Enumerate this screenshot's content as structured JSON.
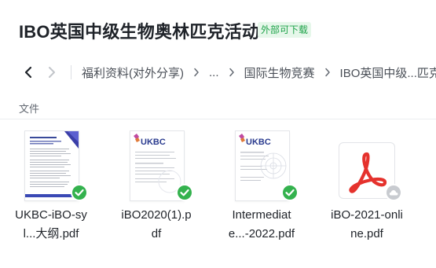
{
  "header": {
    "title": "IBO英国中级生物奥林匹克活动",
    "badge": "外部可下载"
  },
  "nav": {
    "back_icon": "chevron-left-icon",
    "forward_icon": "chevron-right-icon",
    "breadcrumbs": [
      "福利资料(对外分享)",
      "...",
      "国际生物竞赛",
      "IBO英国中级...匹克"
    ]
  },
  "section": {
    "label": "文件"
  },
  "files": [
    {
      "name_line1": "UKBC-iBO-sy",
      "name_line2": "l...大纲.pdf",
      "status": "synced-check-icon",
      "thumb": "document-preview"
    },
    {
      "name_line1": "iBO2020(1).p",
      "name_line2": "df",
      "status": "synced-check-icon",
      "thumb": "document-preview"
    },
    {
      "name_line1": "Intermediat",
      "name_line2": "e...-2022.pdf",
      "status": "synced-check-icon",
      "thumb": "document-preview"
    },
    {
      "name_line1": "iBO-2021-onli",
      "name_line2": "ne.pdf",
      "status": "cloud-icon",
      "thumb": "pdf-file-icon"
    }
  ],
  "colors": {
    "accent_green": "#34b24e",
    "badge_bg": "#e6f7ea",
    "badge_text": "#1fa34a",
    "pdf_red": "#e5322d"
  }
}
